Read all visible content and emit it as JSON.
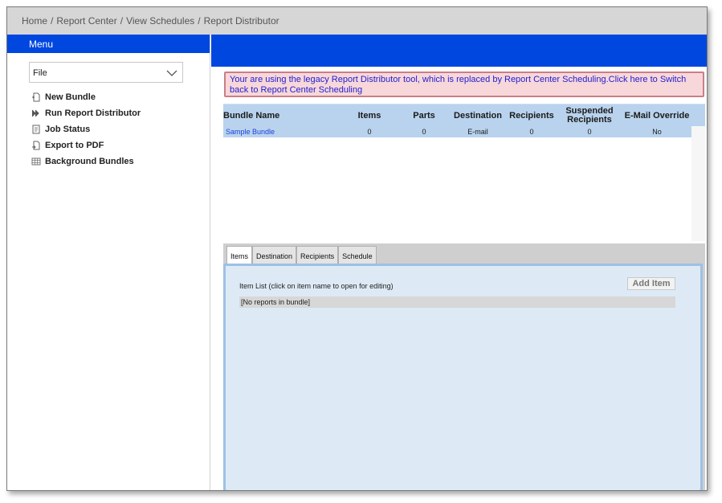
{
  "breadcrumb": [
    "Home",
    "Report Center",
    "View Schedules",
    "Report Distributor"
  ],
  "sidebar": {
    "menu_title": "Menu",
    "file_select": {
      "value": "File"
    },
    "items": [
      {
        "label": "New Bundle",
        "icon": "new-bundle-icon"
      },
      {
        "label": "Run Report Distributor",
        "icon": "run-icon"
      },
      {
        "label": "Job Status",
        "icon": "job-status-icon"
      },
      {
        "label": "Export to PDF",
        "icon": "pdf-export-icon"
      },
      {
        "label": "Background Bundles",
        "icon": "grid-icon"
      }
    ]
  },
  "notice": {
    "text": "Your are using the legacy Report Distributor tool, which is replaced by Report Center Scheduling.Click here to Switch back to Report Center Scheduling"
  },
  "grid": {
    "columns": [
      "Bundle Name",
      "Items",
      "Parts",
      "Destination",
      "Recipients",
      "Suspended Recipients",
      "E-Mail Override"
    ],
    "rows": [
      {
        "name": "Sample Bundle",
        "items": "0",
        "parts": "0",
        "destination": "E-mail",
        "recipients": "0",
        "suspended": "0",
        "override": "No"
      }
    ]
  },
  "tabs": [
    "Items",
    "Destination",
    "Recipients",
    "Schedule"
  ],
  "panel": {
    "label": "Item List (click on item name to open for editing)",
    "add_button": "Add Item",
    "empty_row": "[No reports in bundle]"
  },
  "colors": {
    "accent": "#0047e0",
    "grid_header": "#b9d3ee",
    "notice_bg": "#f8d7da",
    "link": "#2040e0"
  }
}
